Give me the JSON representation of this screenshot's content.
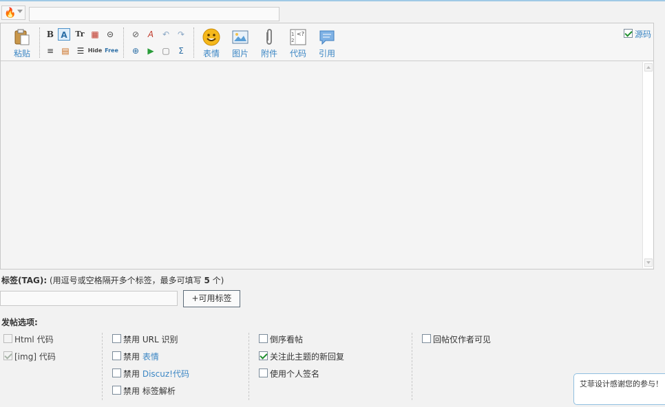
{
  "title_area": {
    "type_icon": "fire-icon",
    "title_value": ""
  },
  "toolbar": {
    "paste_label": "粘贴",
    "emoji_label": "表情",
    "image_label": "图片",
    "attach_label": "附件",
    "code_label": "代码",
    "quote_label": "引用",
    "source_label": "源码",
    "source_checked": true,
    "small_buttons": [
      "B",
      "A",
      "Tr",
      "▦",
      "⊝",
      "≡",
      "▤",
      "☰",
      "Hide",
      "Free",
      "⊘",
      "A",
      "↶",
      "↷",
      "⊕",
      "▶",
      "▢",
      "Σ"
    ]
  },
  "tags": {
    "label": "标签(TAG):",
    "hint_a": "(用逗号或空格隔开多个标签，最多可填写 ",
    "hint_num": "5",
    "hint_b": " 个)",
    "button": "+可用标签"
  },
  "options": {
    "title": "发帖选项:",
    "col1": [
      {
        "label": "Html 代码",
        "checked": false,
        "disabled": true
      },
      {
        "label": "[img] 代码",
        "checked": true,
        "disabled": true
      }
    ],
    "col2": [
      {
        "prefix": "禁用 ",
        "label": "URL 识别"
      },
      {
        "prefix": "禁用 ",
        "label": "表情"
      },
      {
        "prefix": "禁用 ",
        "label": "Discuz!代码"
      },
      {
        "prefix": "禁用 ",
        "label": "标签解析"
      }
    ],
    "col3": [
      {
        "label": "倒序看帖",
        "checked": false
      },
      {
        "label": "关注此主题的新回复",
        "checked": true
      },
      {
        "label": "使用个人签名",
        "checked": false
      }
    ],
    "col4": [
      {
        "label": "回帖仅作者可见",
        "checked": false
      }
    ]
  },
  "tooltip": {
    "text": "艾菲设计感谢您的参与！"
  },
  "colors": {
    "accent": "#3b86c4",
    "check": "#1f8f2e"
  }
}
